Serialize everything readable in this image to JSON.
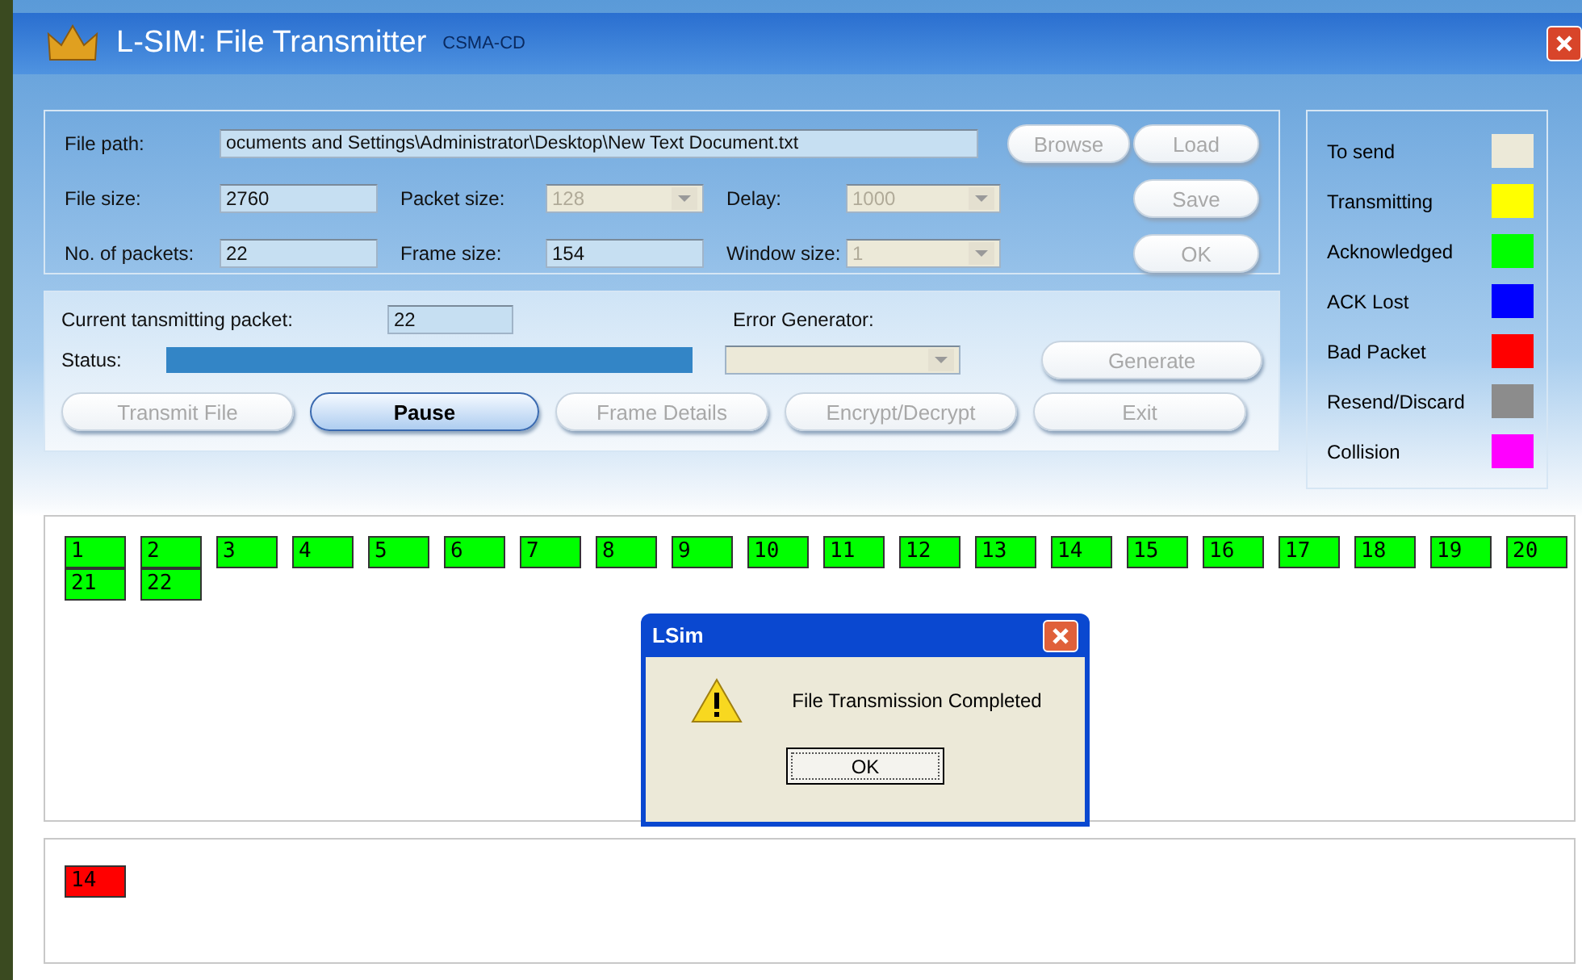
{
  "window": {
    "title": "L-SIM: File Transmitter",
    "subtitle": "CSMA-CD"
  },
  "settings": {
    "file_path": {
      "label": "File path:",
      "value": "ocuments and Settings\\Administrator\\Desktop\\New Text Document.txt"
    },
    "file_size": {
      "label": "File size:",
      "value": "2760"
    },
    "packet_size": {
      "label": "Packet size:",
      "value": "128",
      "disabled": true
    },
    "delay": {
      "label": "Delay:",
      "value": "1000",
      "disabled": true
    },
    "packets": {
      "label": "No. of packets:",
      "value": "22"
    },
    "frame_size": {
      "label": "Frame size:",
      "value": "154"
    },
    "window_size": {
      "label": "Window size:",
      "value": "1",
      "disabled": true
    },
    "buttons": [
      {
        "label": "Browse",
        "disabled": true
      },
      {
        "label": "Load",
        "disabled": true
      },
      {
        "label": "Save",
        "disabled": true
      },
      {
        "label": "OK",
        "disabled": true
      }
    ]
  },
  "transmission": {
    "current_label": "Current tansmitting packet:",
    "current_value": "22",
    "status_label": "Status:",
    "status": {
      "level": 1
    },
    "error_label": "Error Generator:",
    "error_disabled": true,
    "generate": {
      "label": "Generate",
      "disabled": true
    },
    "buttons": [
      {
        "label": "Transmit File",
        "disabled": true
      },
      {
        "label": "Pause",
        "disabled": false
      },
      {
        "label": "Frame Details",
        "disabled": true
      },
      {
        "label": "Encrypt/Decrypt",
        "disabled": true
      },
      {
        "label": "Exit",
        "disabled": true
      }
    ]
  },
  "legend": [
    {
      "label": "To send",
      "color": "#ece9d8"
    },
    {
      "label": "Transmitting",
      "color": "#ffff00"
    },
    {
      "label": "Acknowledged",
      "color": "#00ff00"
    },
    {
      "label": "ACK Lost",
      "color": "#0000ff"
    },
    {
      "label": "Bad Packet",
      "color": "#ff0000"
    },
    {
      "label": "Resend/Discard",
      "color": "#8c8c8c"
    },
    {
      "label": "Collision",
      "color": "#ff00ff"
    }
  ],
  "packets": [
    {
      "label": "1",
      "color": "#00ff00"
    },
    {
      "label": "2",
      "color": "#00ff00"
    },
    {
      "label": "3",
      "color": "#00ff00"
    },
    {
      "label": "4",
      "color": "#00ff00"
    },
    {
      "label": "5",
      "color": "#00ff00"
    },
    {
      "label": "6",
      "color": "#00ff00"
    },
    {
      "label": "7",
      "color": "#00ff00"
    },
    {
      "label": "8",
      "color": "#00ff00"
    },
    {
      "label": "9",
      "color": "#00ff00"
    },
    {
      "label": "10",
      "color": "#00ff00"
    },
    {
      "label": "11",
      "color": "#00ff00"
    },
    {
      "label": "12",
      "color": "#00ff00"
    },
    {
      "label": "13",
      "color": "#00ff00"
    },
    {
      "label": "14",
      "color": "#00ff00"
    },
    {
      "label": "15",
      "color": "#00ff00"
    },
    {
      "label": "16",
      "color": "#00ff00"
    },
    {
      "label": "17",
      "color": "#00ff00"
    },
    {
      "label": "18",
      "color": "#00ff00"
    },
    {
      "label": "19",
      "color": "#00ff00"
    },
    {
      "label": "20",
      "color": "#00ff00"
    },
    {
      "label": "21",
      "color": "#00ff00"
    },
    {
      "label": "22",
      "color": "#00ff00"
    }
  ],
  "errors": [
    {
      "label": "14",
      "color": "#ff0000"
    }
  ],
  "dialog": {
    "title": "LSim",
    "message": "File Transmission Completed",
    "button": "OK"
  }
}
